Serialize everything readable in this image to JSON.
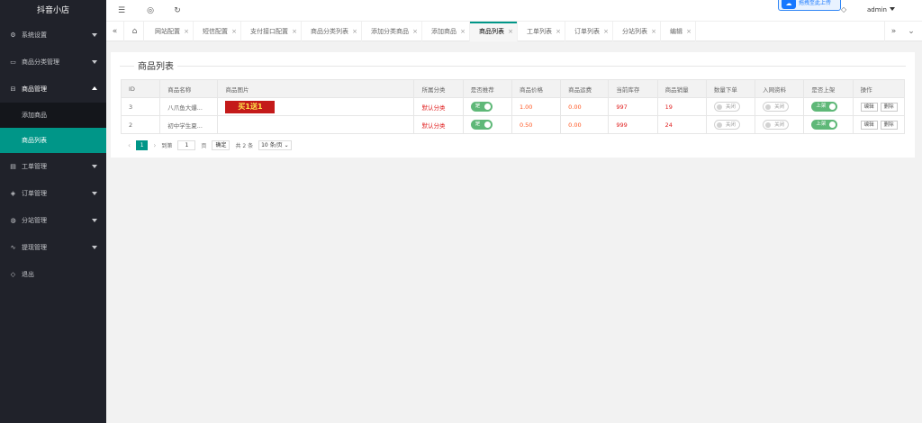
{
  "app": {
    "title": "抖音小店"
  },
  "sidebar": {
    "items": [
      {
        "label": "系统设置",
        "icon": "gear-icon",
        "glyph": "⚙",
        "open": false
      },
      {
        "label": "商品分类管理",
        "icon": "category-icon",
        "glyph": "▭",
        "open": false
      },
      {
        "label": "商品管理",
        "icon": "cart-icon",
        "glyph": "⊟",
        "open": true,
        "children": [
          {
            "label": "添加商品",
            "active": false
          },
          {
            "label": "商品列表",
            "active": true
          }
        ]
      },
      {
        "label": "工单管理",
        "icon": "ticket-icon",
        "glyph": "▤",
        "open": false
      },
      {
        "label": "订单管理",
        "icon": "layers-icon",
        "glyph": "◈",
        "open": false
      },
      {
        "label": "分站管理",
        "icon": "globe-icon",
        "glyph": "◍",
        "open": false
      },
      {
        "label": "提现管理",
        "icon": "pulse-icon",
        "glyph": "∿",
        "open": false
      },
      {
        "label": "退出",
        "icon": "shield-icon",
        "glyph": "◇",
        "open": false
      }
    ]
  },
  "header": {
    "hint": "拖拽至此上传",
    "user": "admin"
  },
  "tabs": [
    {
      "label": "网站配置",
      "active": false
    },
    {
      "label": "短信配置",
      "active": false
    },
    {
      "label": "支付接口配置",
      "active": false
    },
    {
      "label": "商品分类列表",
      "active": false
    },
    {
      "label": "添加分类商品",
      "active": false
    },
    {
      "label": "添加商品",
      "active": false
    },
    {
      "label": "商品列表",
      "active": true
    },
    {
      "label": "工单列表",
      "active": false
    },
    {
      "label": "订单列表",
      "active": false
    },
    {
      "label": "分站列表",
      "active": false
    },
    {
      "label": "编辑",
      "active": false
    }
  ],
  "page": {
    "title": "商品列表"
  },
  "table": {
    "headers": [
      "ID",
      "商品名称",
      "商品图片",
      "所属分类",
      "是否推荐",
      "商品价格",
      "商品运费",
      "当前库存",
      "商品销量",
      "数量下单",
      "入网资料",
      "是否上架",
      "操作"
    ],
    "rows": [
      {
        "id": "3",
        "name": "八爪鱼大爆...",
        "image_text": "买1送1",
        "category": "默认分类",
        "recommend": "是",
        "price": "1.00",
        "freight": "0.00",
        "stock": "997",
        "sales": "19",
        "qty_order": "关闭",
        "net_info": "关闭",
        "on_shelf": "上架",
        "edit": "编辑",
        "delete": "删除"
      },
      {
        "id": "2",
        "name": "初中学生夏...",
        "image_text": "",
        "category": "默认分类",
        "recommend": "是",
        "price": "0.50",
        "freight": "0.00",
        "stock": "999",
        "sales": "24",
        "qty_order": "关闭",
        "net_info": "关闭",
        "on_shelf": "上架",
        "edit": "编辑",
        "delete": "删除"
      }
    ]
  },
  "pager": {
    "prev": "‹",
    "current": "1",
    "next": "›",
    "goto_label": "到第",
    "goto_value": "1",
    "page_unit": "页",
    "confirm": "确定",
    "total": "共 2 条",
    "per_page": "10 条/页"
  },
  "colors": {
    "accent": "#009688",
    "sidebar": "#20222a",
    "switch_on": "#5fb878"
  }
}
